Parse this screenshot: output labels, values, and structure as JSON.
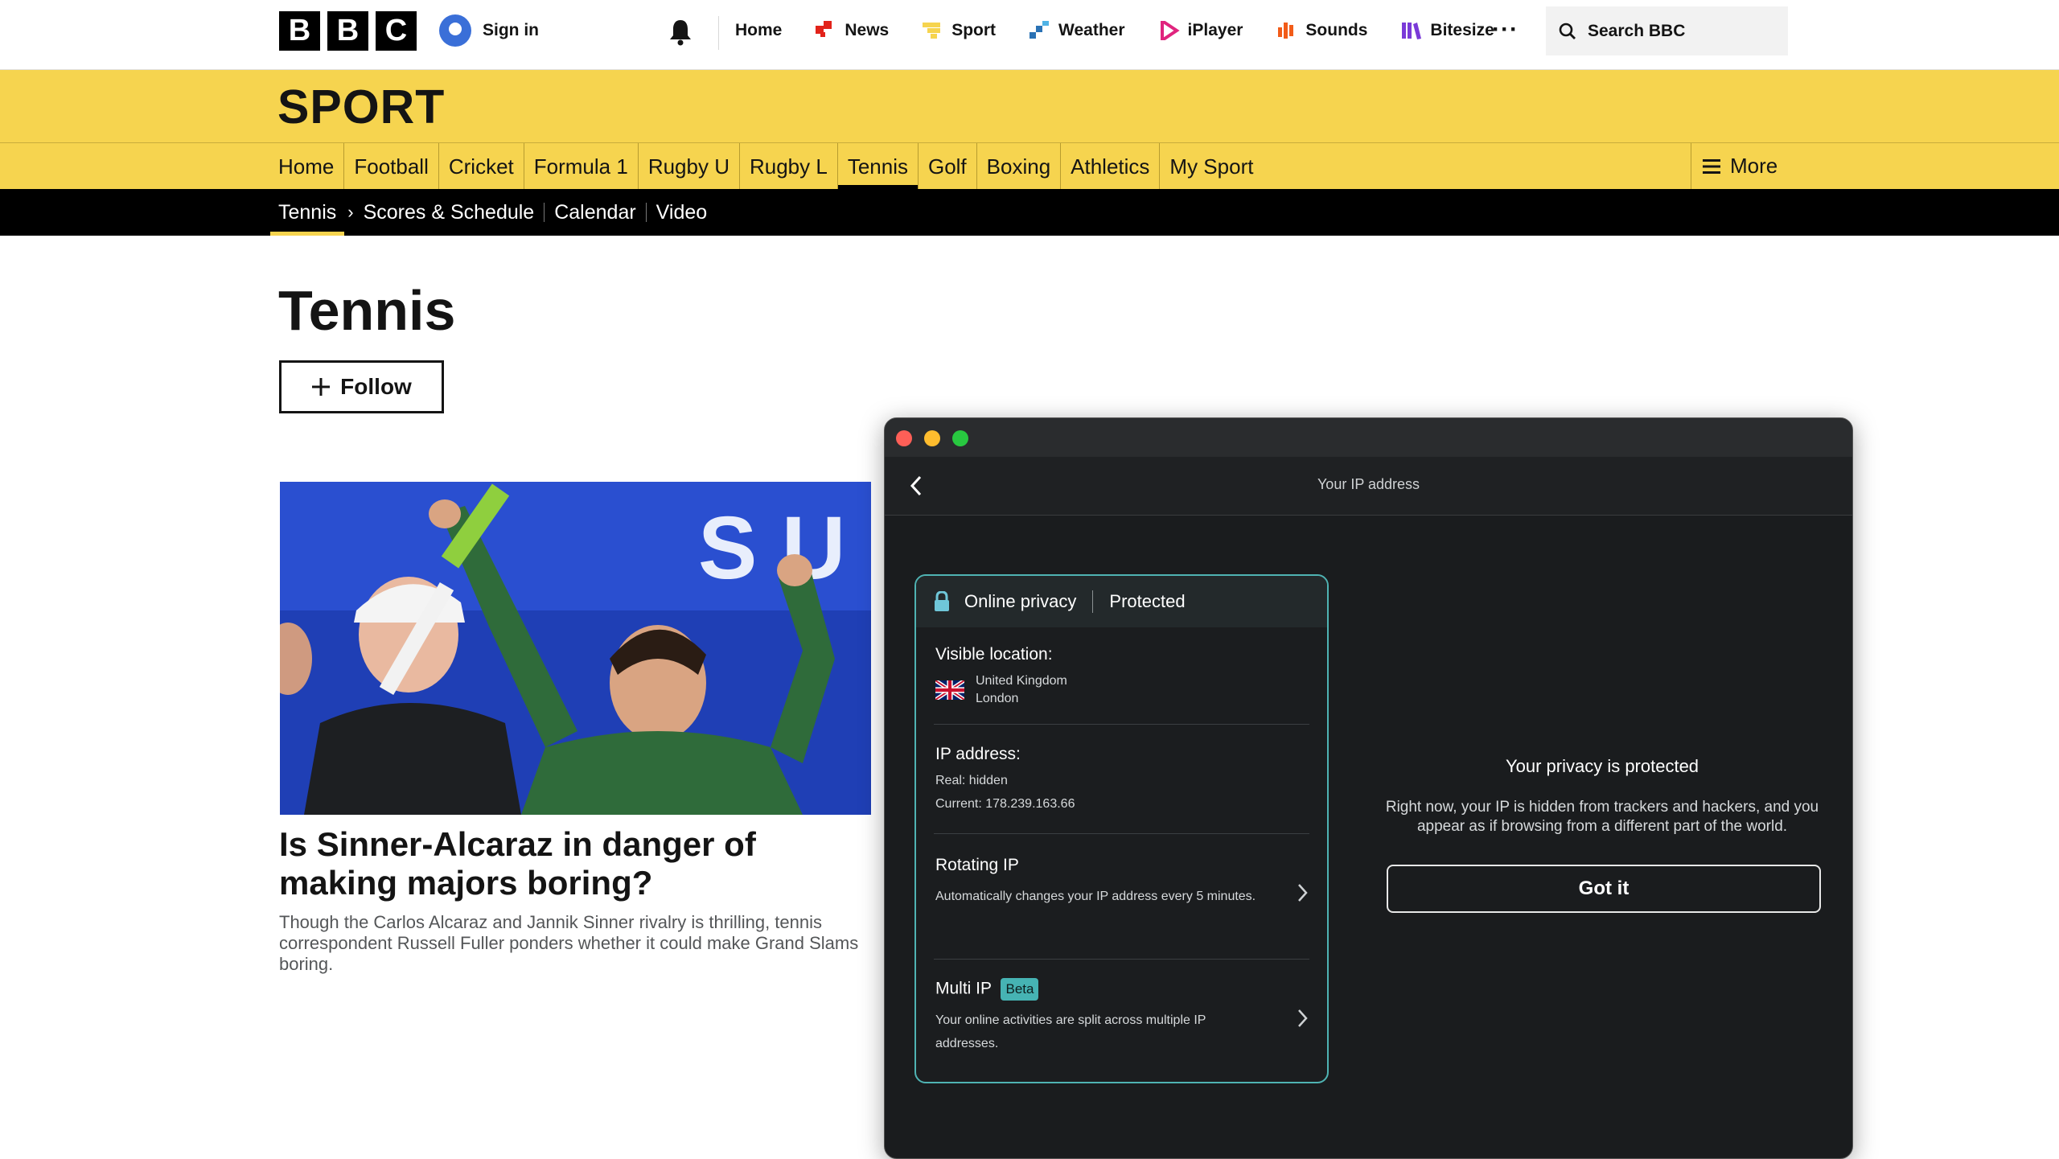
{
  "globalbar": {
    "logo_letters": [
      "B",
      "B",
      "C"
    ],
    "sign_in": "Sign in",
    "nav": [
      {
        "label": "Home",
        "icon": "none"
      },
      {
        "label": "News",
        "icon": "news-icon",
        "color": "#e2231a"
      },
      {
        "label": "Sport",
        "icon": "sport-icon",
        "color": "#f6d44f"
      },
      {
        "label": "Weather",
        "icon": "weather-icon",
        "color": "#2a72b5"
      },
      {
        "label": "iPlayer",
        "icon": "iplayer-icon",
        "color": "#e0247e"
      },
      {
        "label": "Sounds",
        "icon": "sounds-icon",
        "color": "#f25c19"
      },
      {
        "label": "Bitesize",
        "icon": "bitesize-icon",
        "color": "#7a3ad8"
      }
    ],
    "more_dots": "···",
    "search_placeholder": "Search BBC"
  },
  "sport": {
    "title": "SPORT",
    "nav": [
      "Home",
      "Football",
      "Cricket",
      "Formula 1",
      "Rugby U",
      "Rugby L",
      "Tennis",
      "Golf",
      "Boxing",
      "Athletics",
      "My Sport"
    ],
    "active": "Tennis",
    "more": "More",
    "accent": "#f6d44f"
  },
  "subnav": {
    "current": "Tennis",
    "items": [
      "Scores & Schedule",
      "Calendar",
      "Video"
    ]
  },
  "page": {
    "title": "Tennis",
    "follow": "Follow",
    "headline": "Is Sinner-Alcaraz in danger of making majors boring?",
    "summary": "Though the Carlos Alcaraz and Jannik Sinner rivalry is thrilling, tennis correspondent Russell Fuller ponders whether it could make Grand Slams boring."
  },
  "vpn": {
    "header_title": "Your IP address",
    "status_label": "Online privacy",
    "status_value": "Protected",
    "visible_location_label": "Visible location:",
    "country": "United Kingdom",
    "city": "London",
    "ip_label": "IP address:",
    "ip_real": "Real: hidden",
    "ip_current": "Current: 178.239.163.66",
    "rotating_title": "Rotating IP",
    "rotating_desc": "Automatically changes your IP address every 5 minutes.",
    "multi_title": "Multi IP",
    "multi_badge": "Beta",
    "multi_desc": "Your online activities are split across multiple IP addresses.",
    "right_heading": "Your privacy is protected",
    "right_body": "Right now, your IP is hidden from trackers and hackers, and you appear as if browsing from a different part of the world.",
    "got_it": "Got it",
    "accent": "#4fb3b3"
  }
}
